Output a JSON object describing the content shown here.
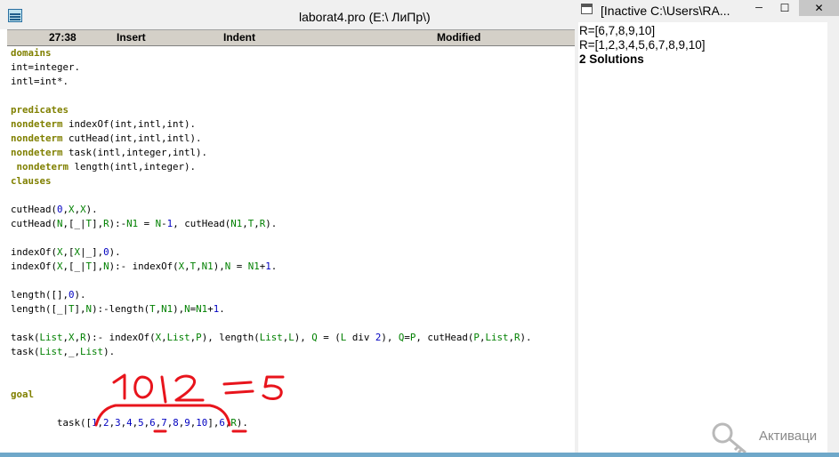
{
  "editor": {
    "title": "laborat4.pro (E:\\ ЛиПр\\)",
    "status": {
      "time": "27:38",
      "insert": "Insert",
      "indent": "Indent",
      "modified": "Modified"
    },
    "code_lines": [
      [
        {
          "t": "domains",
          "c": "kw"
        }
      ],
      [
        {
          "t": "int=integer."
        }
      ],
      [
        {
          "t": "intl=int*."
        }
      ],
      [],
      [
        {
          "t": "predicates",
          "c": "kw"
        }
      ],
      [
        {
          "t": "nondeterm",
          "c": "kw"
        },
        {
          "t": " indexOf(int,intl,int)."
        }
      ],
      [
        {
          "t": "nondeterm",
          "c": "kw"
        },
        {
          "t": " cutHead(int,intl,intl)."
        }
      ],
      [
        {
          "t": "nondeterm",
          "c": "kw"
        },
        {
          "t": " task(intl,integer,intl)."
        }
      ],
      [
        {
          "t": " "
        },
        {
          "t": "nondeterm",
          "c": "kw"
        },
        {
          "t": " length(intl,integer)."
        }
      ],
      [
        {
          "t": "clauses",
          "c": "kw"
        }
      ],
      [],
      [
        {
          "t": "cutHead("
        },
        {
          "t": "0",
          "c": "n"
        },
        {
          "t": ","
        },
        {
          "t": "X",
          "c": "v"
        },
        {
          "t": ","
        },
        {
          "t": "X",
          "c": "v"
        },
        {
          "t": ")."
        }
      ],
      [
        {
          "t": "cutHead("
        },
        {
          "t": "N",
          "c": "v"
        },
        {
          "t": ",[_|"
        },
        {
          "t": "T",
          "c": "v"
        },
        {
          "t": "],"
        },
        {
          "t": "R",
          "c": "v"
        },
        {
          "t": "):-"
        },
        {
          "t": "N1",
          "c": "v"
        },
        {
          "t": " = "
        },
        {
          "t": "N",
          "c": "v"
        },
        {
          "t": "-"
        },
        {
          "t": "1",
          "c": "n"
        },
        {
          "t": ", cutHead("
        },
        {
          "t": "N1",
          "c": "v"
        },
        {
          "t": ","
        },
        {
          "t": "T",
          "c": "v"
        },
        {
          "t": ","
        },
        {
          "t": "R",
          "c": "v"
        },
        {
          "t": ")."
        }
      ],
      [],
      [
        {
          "t": "indexOf("
        },
        {
          "t": "X",
          "c": "v"
        },
        {
          "t": ",["
        },
        {
          "t": "X",
          "c": "v"
        },
        {
          "t": "|_],"
        },
        {
          "t": "0",
          "c": "n"
        },
        {
          "t": ")."
        }
      ],
      [
        {
          "t": "indexOf("
        },
        {
          "t": "X",
          "c": "v"
        },
        {
          "t": ",[_|"
        },
        {
          "t": "T",
          "c": "v"
        },
        {
          "t": "],"
        },
        {
          "t": "N",
          "c": "v"
        },
        {
          "t": "):- indexOf("
        },
        {
          "t": "X",
          "c": "v"
        },
        {
          "t": ","
        },
        {
          "t": "T",
          "c": "v"
        },
        {
          "t": ","
        },
        {
          "t": "N1",
          "c": "v"
        },
        {
          "t": "),"
        },
        {
          "t": "N",
          "c": "v"
        },
        {
          "t": " = "
        },
        {
          "t": "N1",
          "c": "v"
        },
        {
          "t": "+"
        },
        {
          "t": "1",
          "c": "n"
        },
        {
          "t": "."
        }
      ],
      [],
      [
        {
          "t": "length([],"
        },
        {
          "t": "0",
          "c": "n"
        },
        {
          "t": ")."
        }
      ],
      [
        {
          "t": "length([_|"
        },
        {
          "t": "T",
          "c": "v"
        },
        {
          "t": "],"
        },
        {
          "t": "N",
          "c": "v"
        },
        {
          "t": "):-length("
        },
        {
          "t": "T",
          "c": "v"
        },
        {
          "t": ","
        },
        {
          "t": "N1",
          "c": "v"
        },
        {
          "t": "),"
        },
        {
          "t": "N",
          "c": "v"
        },
        {
          "t": "="
        },
        {
          "t": "N1",
          "c": "v"
        },
        {
          "t": "+"
        },
        {
          "t": "1",
          "c": "n"
        },
        {
          "t": "."
        }
      ],
      [],
      [
        {
          "t": "task("
        },
        {
          "t": "List",
          "c": "v"
        },
        {
          "t": ","
        },
        {
          "t": "X",
          "c": "v"
        },
        {
          "t": ","
        },
        {
          "t": "R",
          "c": "v"
        },
        {
          "t": "):- indexOf("
        },
        {
          "t": "X",
          "c": "v"
        },
        {
          "t": ","
        },
        {
          "t": "List",
          "c": "v"
        },
        {
          "t": ","
        },
        {
          "t": "P",
          "c": "v"
        },
        {
          "t": "), length("
        },
        {
          "t": "List",
          "c": "v"
        },
        {
          "t": ","
        },
        {
          "t": "L",
          "c": "v"
        },
        {
          "t": "), "
        },
        {
          "t": "Q",
          "c": "v"
        },
        {
          "t": " = ("
        },
        {
          "t": "L",
          "c": "v"
        },
        {
          "t": " div "
        },
        {
          "t": "2",
          "c": "n"
        },
        {
          "t": "), "
        },
        {
          "t": "Q",
          "c": "v"
        },
        {
          "t": "="
        },
        {
          "t": "P",
          "c": "v"
        },
        {
          "t": ", cutHead("
        },
        {
          "t": "P",
          "c": "v"
        },
        {
          "t": ","
        },
        {
          "t": "List",
          "c": "v"
        },
        {
          "t": ","
        },
        {
          "t": "R",
          "c": "v"
        },
        {
          "t": ")."
        }
      ],
      [
        {
          "t": "task("
        },
        {
          "t": "List",
          "c": "v"
        },
        {
          "t": ",_,"
        },
        {
          "t": "List",
          "c": "v"
        },
        {
          "t": ")."
        }
      ],
      [],
      [],
      [
        {
          "t": "goal",
          "c": "kw"
        }
      ],
      [],
      [
        {
          "t": "        task(["
        },
        {
          "t": "1",
          "c": "n"
        },
        {
          "t": ","
        },
        {
          "t": "2",
          "c": "n"
        },
        {
          "t": ","
        },
        {
          "t": "3",
          "c": "n"
        },
        {
          "t": ","
        },
        {
          "t": "4",
          "c": "n"
        },
        {
          "t": ","
        },
        {
          "t": "5",
          "c": "n"
        },
        {
          "t": ","
        },
        {
          "t": "6",
          "c": "n"
        },
        {
          "t": ","
        },
        {
          "t": "7",
          "c": "n"
        },
        {
          "t": ","
        },
        {
          "t": "8",
          "c": "n"
        },
        {
          "t": ","
        },
        {
          "t": "9",
          "c": "n"
        },
        {
          "t": ","
        },
        {
          "t": "10",
          "c": "n"
        },
        {
          "t": "],"
        },
        {
          "t": "6",
          "c": "n"
        },
        {
          "t": ","
        },
        {
          "t": "R",
          "c": "v"
        },
        {
          "t": ")."
        }
      ]
    ],
    "annotation": {
      "text": "10/2 = 5",
      "color": "#e8141c"
    }
  },
  "output": {
    "title": "[Inactive C:\\Users\\RA...",
    "lines": [
      "R=[6,7,8,9,10]",
      "R=[1,2,3,4,5,6,7,8,9,10]",
      "2 Solutions"
    ],
    "buttons": {
      "minimize_icon": "minimize-icon",
      "maximize_icon": "maximize-icon",
      "close_icon": "close-icon"
    }
  },
  "watermark": {
    "text": "Активаци"
  },
  "colors": {
    "keyword": "#808000",
    "variable": "#008000",
    "number": "#0000c0",
    "annotation": "#e8141c"
  }
}
